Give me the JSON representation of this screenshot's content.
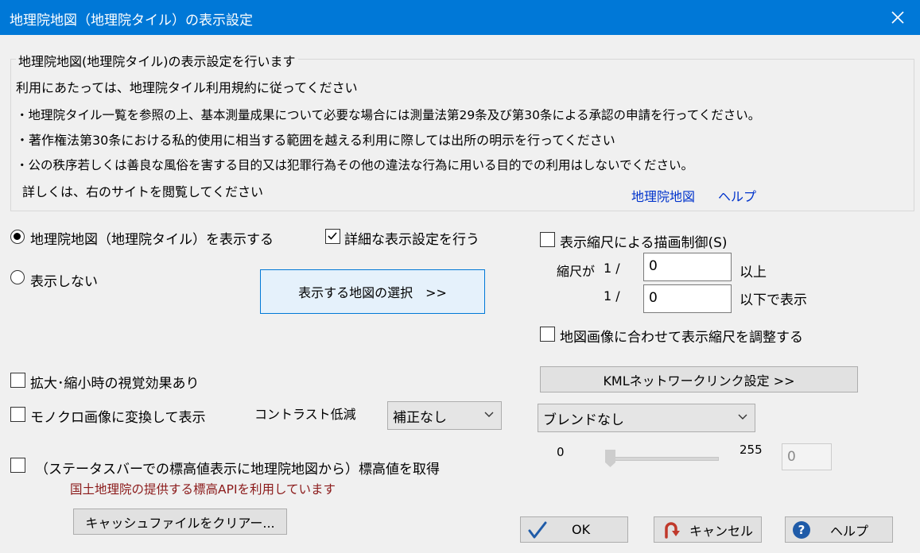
{
  "window": {
    "title": "地理院地図（地理院タイル）の表示設定"
  },
  "info": {
    "group_title": "地理院地図(地理院タイル)の表示設定を行います",
    "line1": "利用にあたっては、地理院タイル利用規約に従ってください",
    "bullet1": "・地理院タイル一覧を参照の上、基本測量成果について必要な場合には測量法第29条及び第30条による承認の申請を行ってください。",
    "bullet2": "・著作権法第30条における私的使用に相当する範囲を越える利用に際しては出所の明示を行ってください",
    "bullet3": "・公の秩序若しくは善良な風俗を害する目的又は犯罪行為その他の違法な行為に用いる目的での利用はしないでください。",
    "details": "詳しくは、右のサイトを閲覧してください",
    "link_map": "地理院地図",
    "link_help": "ヘルプ"
  },
  "display": {
    "radio_show": "地理院地図（地理院タイル）を表示する",
    "radio_show_selected": true,
    "radio_hide": "表示しない",
    "detailed_settings": "詳細な表示設定を行う",
    "detailed_checked": true,
    "select_map_button": "表示する地図の選択　>>"
  },
  "scale": {
    "control_label": "表示縮尺による描画制御(S)",
    "scale_prefix": "縮尺が",
    "one_over_1": "1 /",
    "min_value": "0",
    "above": "以上",
    "one_over_2": "1 /",
    "max_value": "0",
    "below": "以下で表示",
    "adjust_label": "地図画像に合わせて表示縮尺を調整する"
  },
  "effects": {
    "zoom_effect": "拡大･縮小時の視覚効果あり",
    "mono": "モノクロ画像に変換して表示",
    "contrast_label": "コントラスト低減",
    "contrast_value": "補正なし",
    "kml_button": "KMLネットワークリンク設定 >>",
    "blend_value": "ブレンドなし",
    "slider_min": "0",
    "slider_max": "255",
    "slider_value": "0"
  },
  "elevation": {
    "label": "（ステータスバーでの標高値表示に地理院地図から）標高値を取得",
    "note": "国土地理院の提供する標高APIを利用しています",
    "clear_cache_button": "キャッシュファイルをクリアー..."
  },
  "footer": {
    "ok": "OK",
    "cancel": "キャンセル",
    "help": "ヘルプ"
  },
  "colors": {
    "titlebar": "#0078d7",
    "link": "#0033cc",
    "note": "#8b1a1a",
    "cancel_icon": "#c0392b",
    "help_icon": "#1f5ba8"
  },
  "icons": {
    "close": "close-icon",
    "ok": "checkmark-icon",
    "cancel": "undo-arrow-icon",
    "help": "question-circle-icon",
    "dropdown": "chevron-down-icon"
  }
}
